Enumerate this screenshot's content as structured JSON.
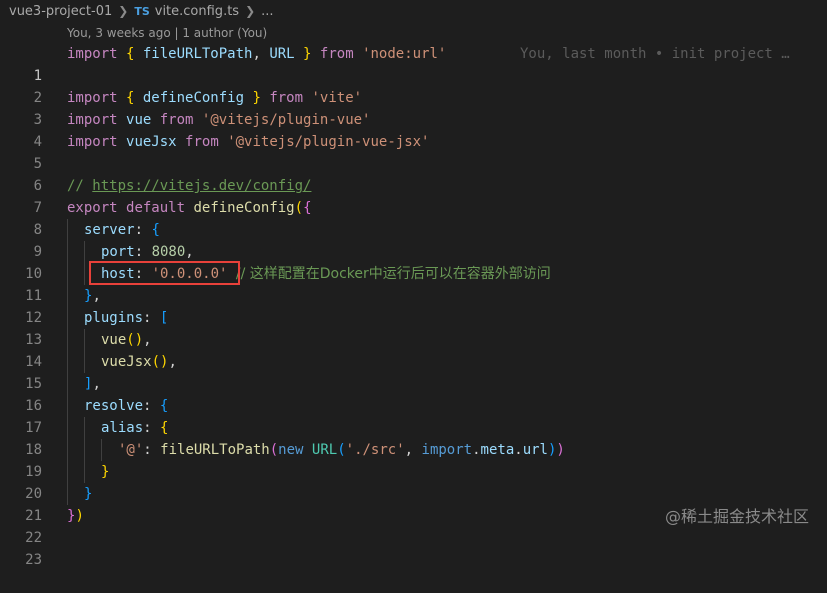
{
  "breadcrumb": {
    "folder": "vue3-project-01",
    "file_icon": "TS",
    "file": "vite.config.ts",
    "more": "..."
  },
  "codelens": {
    "text": "You, 3 weeks ago | 1 author (You)"
  },
  "blame": {
    "text": "You, last month • init project …"
  },
  "lines": {
    "l1": {
      "num": "1",
      "t": [
        "import",
        " { ",
        "fileURLToPath",
        ", ",
        "URL",
        " } ",
        "from",
        " ",
        "'node:url'"
      ]
    },
    "l2": {
      "num": "2"
    },
    "l3": {
      "num": "3",
      "t": [
        "import",
        " { ",
        "defineConfig",
        " } ",
        "from",
        " ",
        "'vite'"
      ]
    },
    "l4": {
      "num": "4",
      "t": [
        "import",
        " ",
        "vue",
        " ",
        "from",
        " ",
        "'@vitejs/plugin-vue'"
      ]
    },
    "l5": {
      "num": "5",
      "t": [
        "import",
        " ",
        "vueJsx",
        " ",
        "from",
        " ",
        "'@vitejs/plugin-vue-jsx'"
      ]
    },
    "l6": {
      "num": "6"
    },
    "l7": {
      "num": "7",
      "t": [
        "// ",
        "https://vitejs.dev/config/"
      ]
    },
    "l8": {
      "num": "8",
      "t": [
        "export",
        " ",
        "default",
        " ",
        "defineConfig",
        "(",
        "{"
      ]
    },
    "l9": {
      "num": "9",
      "t": [
        "server",
        ": ",
        "{"
      ]
    },
    "l10": {
      "num": "10",
      "t": [
        "port",
        ": ",
        "8080",
        ","
      ]
    },
    "l11": {
      "num": "11",
      "t": [
        "host",
        ": ",
        "'0.0.0.0'",
        " ",
        "// 这样配置在Docker中运行后可以在容器外部访问"
      ]
    },
    "l12": {
      "num": "12",
      "t": [
        "}",
        ","
      ]
    },
    "l13": {
      "num": "13",
      "t": [
        "plugins",
        ": ",
        "["
      ]
    },
    "l14": {
      "num": "14",
      "t": [
        "vue",
        "()",
        ","
      ]
    },
    "l15": {
      "num": "15",
      "t": [
        "vueJsx",
        "()",
        ","
      ]
    },
    "l16": {
      "num": "16",
      "t": [
        "]",
        ","
      ]
    },
    "l17": {
      "num": "17",
      "t": [
        "resolve",
        ": ",
        "{"
      ]
    },
    "l18": {
      "num": "18",
      "t": [
        "alias",
        ": ",
        "{"
      ]
    },
    "l19": {
      "num": "19",
      "t": [
        "'@'",
        ": ",
        "fileURLToPath",
        "(",
        "new",
        " ",
        "URL",
        "(",
        "'./src'",
        ", ",
        "import",
        ".",
        "meta",
        ".",
        "url",
        ")",
        ")"
      ]
    },
    "l20": {
      "num": "20",
      "t": [
        "}"
      ]
    },
    "l21": {
      "num": "21",
      "t": [
        "}"
      ]
    },
    "l22": {
      "num": "22",
      "t": [
        "}",
        ")"
      ]
    },
    "l23": {
      "num": "23"
    }
  },
  "watermark": "@稀土掘金技术社区"
}
